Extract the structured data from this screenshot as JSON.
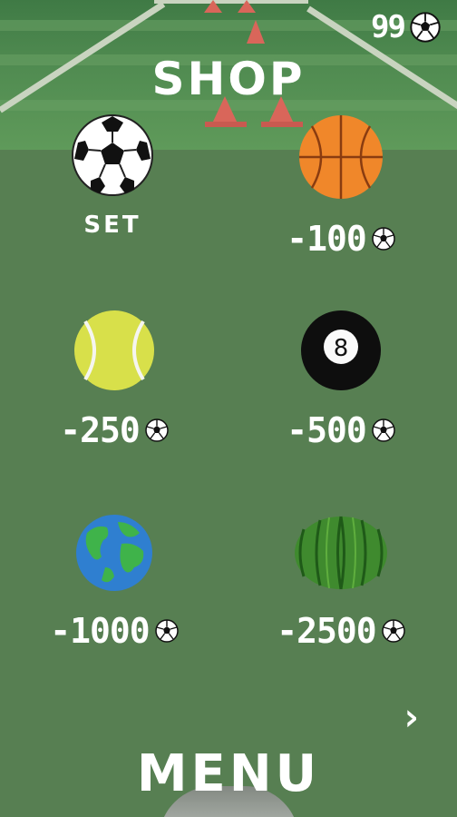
{
  "header": {
    "coins": "99",
    "coin_icon": "soccer-ball-icon"
  },
  "title": "SHOP",
  "items": [
    {
      "name": "soccer-ball",
      "label": "SET"
    },
    {
      "name": "basketball",
      "price": "-100"
    },
    {
      "name": "tennis-ball",
      "price": "-250"
    },
    {
      "name": "eight-ball",
      "price": "-500",
      "ball_number": "8"
    },
    {
      "name": "earth",
      "price": "-1000"
    },
    {
      "name": "watermelon",
      "price": "-2500"
    }
  ],
  "next_icon": "chevron-right-icon",
  "menu_label": "MENU",
  "colors": {
    "field": "#5a8455",
    "basketball": "#f0872a",
    "tennis": "#d8e04a",
    "cone": "#d9665a"
  }
}
